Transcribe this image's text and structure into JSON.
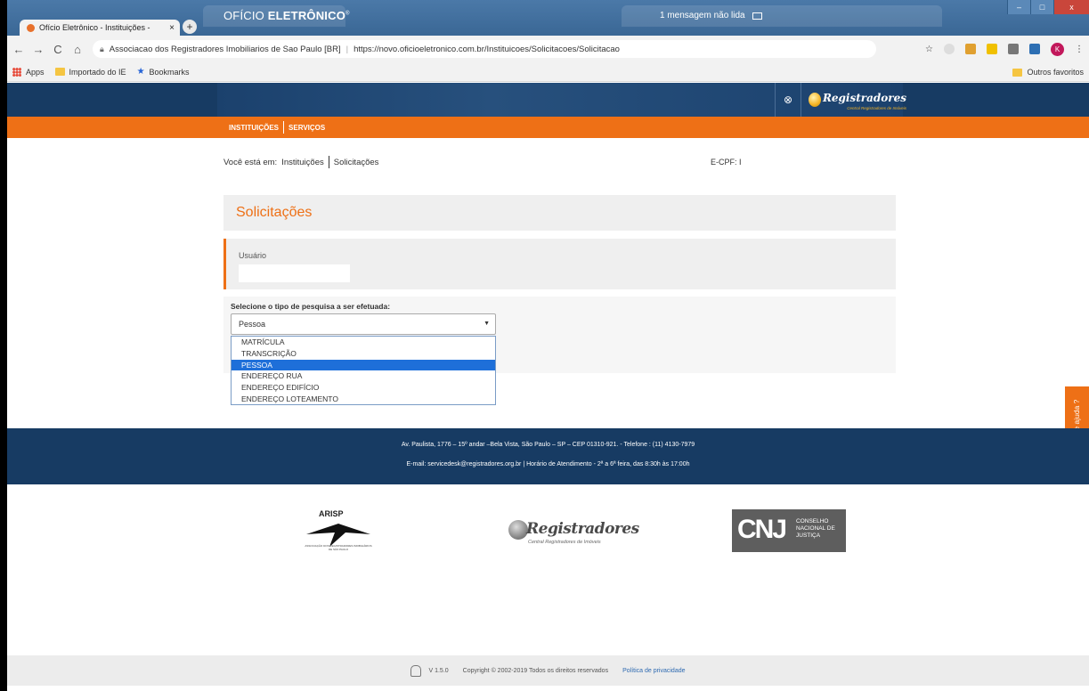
{
  "browser": {
    "tab_title": "Ofício Eletrônico - Instituições - ",
    "tab_close": "×",
    "new_tab": "+",
    "omnibox_org": "Associacao dos Registradores Imobiliarios de Sao Paulo [BR]",
    "omnibox_sep": "|",
    "omnibox_url": "https://novo.oficioeletronico.com.br/Instituicoes/Solicitacoes/Solicitacao",
    "bookmarks": [
      "Apps",
      "Importado do IE",
      "Bookmarks"
    ],
    "other_favorites": "Outros favoritos",
    "avatar_letter": "K"
  },
  "header": {
    "brand_a": "OFÍCIO ",
    "brand_b": "ELETRÔNICO",
    "brand_reg": "®",
    "messages": "1 mensagem não lida",
    "logout_glyph": "⊗",
    "logo_text": "Registradores",
    "logo_sub": "Central Registradores de Imóveis"
  },
  "menu": {
    "items": [
      "INSTITUIÇÕES",
      "SERVIÇOS"
    ]
  },
  "breadcrumb": {
    "prefix": "Você está em:",
    "items": [
      "Instituições",
      "Solicitações"
    ]
  },
  "ecpf": "E-CPF: I",
  "page": {
    "title": "Solicitações",
    "user_label": "Usuário",
    "user_value": "",
    "search_label": "Selecione o tipo de pesquisa a ser efetuada:",
    "select_value": "Pessoa",
    "select_arrow": "▼",
    "options": [
      "MATRÍCULA",
      "TRANSCRIÇÃO",
      "PESSOA",
      "ENDEREÇO RUA",
      "ENDEREÇO EDIFÍCIO",
      "ENDEREÇO LOTEAMENTO"
    ],
    "selected_option": "PESSOA"
  },
  "help": "Precisa de ajuda ?",
  "footer": {
    "address": "Av. Paulista, 1776 – 15º andar –Bela Vista, São Paulo – SP – CEP 01310-921. - Telefone : (11) 4130-7979",
    "email": "E-mail: servicedesk@registradores.org.br | Horário de Atendimento - 2ª a 6ª feira, das 8:30h às 17:00h"
  },
  "logos": {
    "arisp": "ARISP",
    "arisp_caption": "ASSOCIAÇÃO DOS REGISTRADORES IMOBILIÁRIOS DE SÃO PAULO",
    "registradores": "Registradores",
    "registradores_sub": "Central Registradores de Imóveis",
    "cnj": "CNJ",
    "cnj_text": "CONSELHO NACIONAL DE JUSTIÇA"
  },
  "bottom": {
    "version": "V 1.5.0",
    "copyright": "Copyright © 2002-2019 Todos os direitos reservados",
    "privacy": "Política de privacidade"
  },
  "colors": {
    "navy": "#173b63",
    "orange": "#ee7016",
    "selection": "#1e6fd9"
  }
}
